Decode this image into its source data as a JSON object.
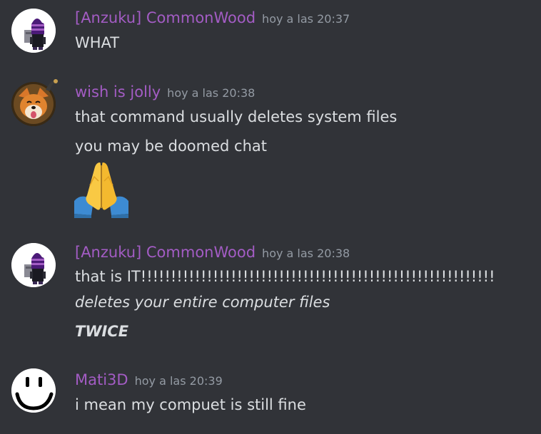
{
  "messages": [
    {
      "author": "[Anzuku] CommonWood",
      "timestamp": "hoy a las 20:37",
      "lines": [
        "WHAT"
      ],
      "avatar_icon": "purple-hooded-robot-avatar"
    },
    {
      "author": "wish is jolly",
      "timestamp": "hoy a las 20:38",
      "lines": [
        "that command usually deletes system files",
        "you may be doomed chat"
      ],
      "emoji": "folded-hands-emoji",
      "avatar_icon": "fox-avatar"
    },
    {
      "author": "[Anzuku] CommonWood",
      "timestamp": "hoy a las 20:38",
      "lines": [
        "that is IT!!!!!!!!!!!!!!!!!!!!!!!!!!!!!!!!!!!!!!!!!!!!!!!!!!!!!!!!!!!",
        "deletes your entire computer files",
        "TWICE"
      ],
      "avatar_icon": "purple-hooded-robot-avatar"
    },
    {
      "author": "Mati3D",
      "timestamp": "hoy a las 20:39",
      "lines": [
        "i mean my compuet is still fine"
      ],
      "avatar_icon": "smiley-face-avatar"
    }
  ],
  "colors": {
    "background": "#313338",
    "username": "#a35cc4",
    "timestamp": "#949ba4",
    "text": "#dbdee1"
  }
}
